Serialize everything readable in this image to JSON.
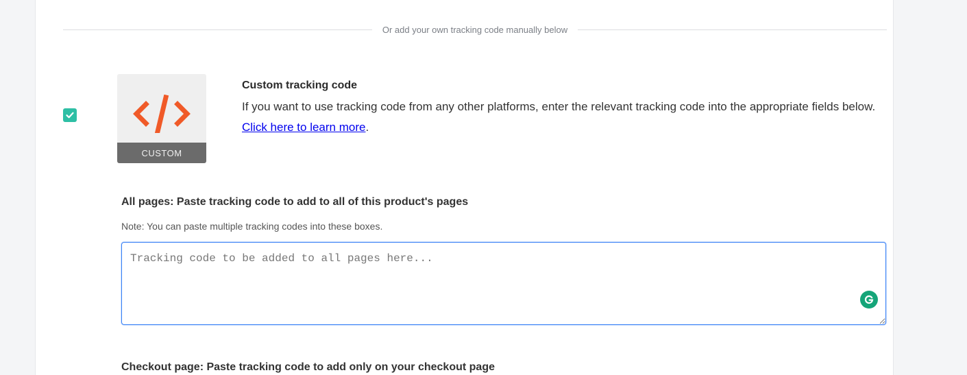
{
  "divider": {
    "text": "Or add your own tracking code manually below"
  },
  "custom_tracking": {
    "checked": true,
    "tile_label": "CUSTOM",
    "title": "Custom tracking code",
    "description": "If you want to use tracking code from any other platforms, enter the relevant tracking code into the appropriate fields below.",
    "learn_more_link": "Click here to learn more",
    "learn_more_suffix": "."
  },
  "all_pages": {
    "label": "All pages: Paste tracking code to add to all of this product's pages",
    "note": "Note: You can paste multiple tracking codes into these boxes.",
    "value": "",
    "placeholder": "Tracking code to be added to all pages here..."
  },
  "checkout_page": {
    "label": "Checkout page: Paste tracking code to add only on your checkout page"
  },
  "colors": {
    "checkbox": "#2ebfa5",
    "code_icon": "#f05a28",
    "focus_border": "#3b82f6",
    "grammarly": "#15a579"
  }
}
